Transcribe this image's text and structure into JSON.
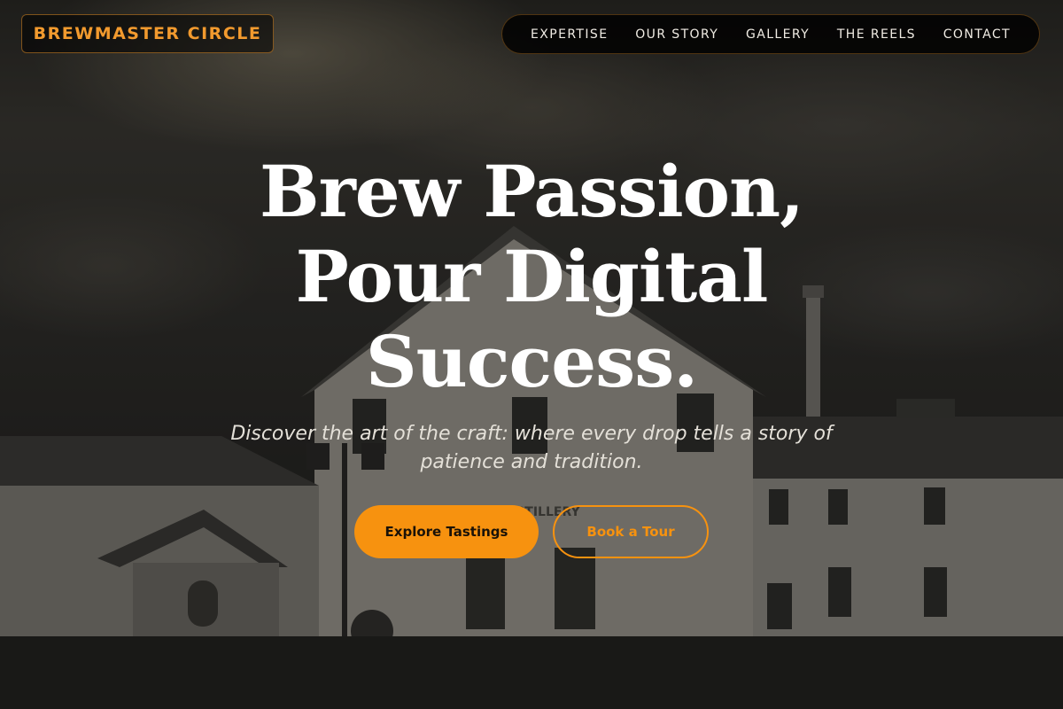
{
  "brand": {
    "name": "BREWMASTER CIRCLE"
  },
  "nav": {
    "items": [
      {
        "label": "EXPERTISE"
      },
      {
        "label": "OUR STORY"
      },
      {
        "label": "GALLERY"
      },
      {
        "label": "THE REELS"
      },
      {
        "label": "CONTACT"
      }
    ]
  },
  "hero": {
    "headline": "Brew Passion, Pour Digital Success.",
    "tagline": "Discover the art of the craft: where every drop tells a story of patience and tradition.",
    "primary_cta": "Explore Tastings",
    "secondary_cta": "Book a Tour",
    "sign_text": "DISTILLERY"
  },
  "colors": {
    "accent": "#f7920f",
    "brand_text": "#f29a2e",
    "headline": "#ffffff",
    "background": "#1a1a1a"
  }
}
